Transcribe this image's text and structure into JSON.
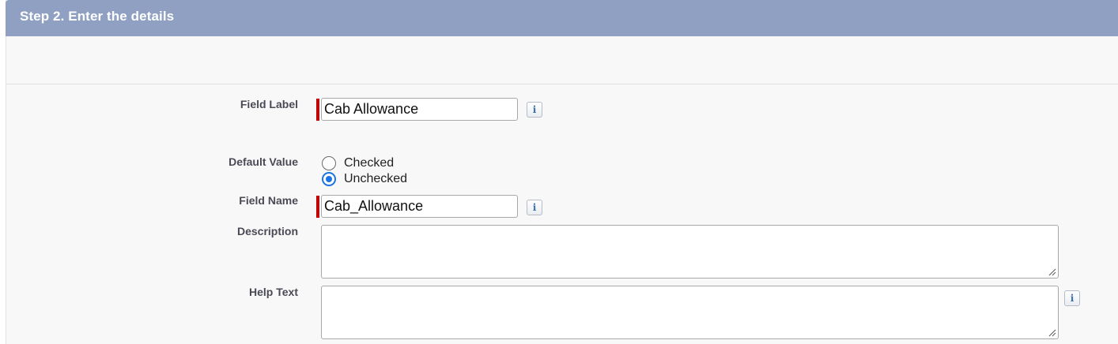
{
  "section": {
    "title": "Step 2. Enter the details"
  },
  "form": {
    "field_label": {
      "label": "Field Label",
      "value": "Cab Allowance",
      "info": "i"
    },
    "default_value": {
      "label": "Default Value",
      "options": [
        {
          "label": "Checked",
          "selected": false
        },
        {
          "label": "Unchecked",
          "selected": true
        }
      ]
    },
    "field_name": {
      "label": "Field Name",
      "value": "Cab_Allowance",
      "info": "i"
    },
    "description": {
      "label": "Description",
      "value": ""
    },
    "help_text": {
      "label": "Help Text",
      "value": "",
      "info": "i"
    }
  },
  "colors": {
    "header_bg": "#8fa0c2",
    "required_bar": "#c00000",
    "radio_selected": "#1a73e8"
  }
}
